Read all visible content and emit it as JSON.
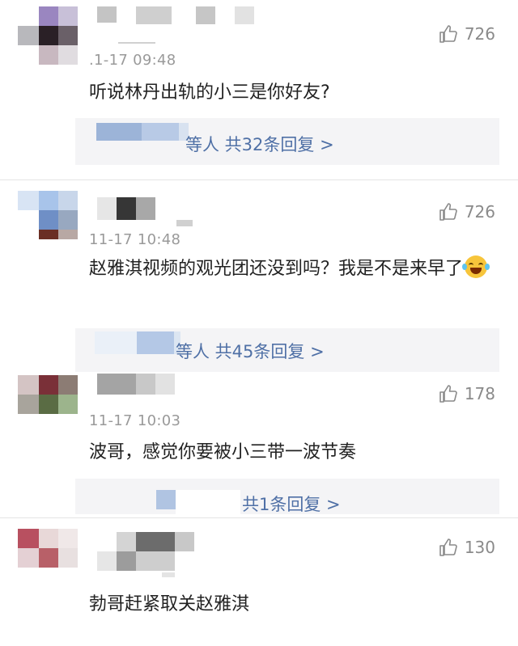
{
  "comments": [
    {
      "likes": "726",
      "time": ".1-17 09:48",
      "text": "听说林丹出轨的小三是你好友?",
      "reply": "等人 共32条回复 >"
    },
    {
      "likes": "726",
      "time": "11-17 10:48",
      "text": "赵雅淇视频的观光团还没到吗？我是不是来早了",
      "emoji": "laughing-tears-emoji",
      "reply": "等人 共45条回复 >"
    },
    {
      "likes": "178",
      "time": "11-17 10:03",
      "text": "波哥，感觉你要被小三带一波节奏",
      "reply": "共1条回复 >"
    },
    {
      "likes": "130",
      "text": "勃哥赶紧取关赵雅淇"
    }
  ],
  "icons": {
    "like": "thumbs-up-icon"
  },
  "colors": {
    "reply_link": "#4f70a6",
    "reply_bg": "#f4f4f6",
    "meta": "#9a9a9a"
  }
}
